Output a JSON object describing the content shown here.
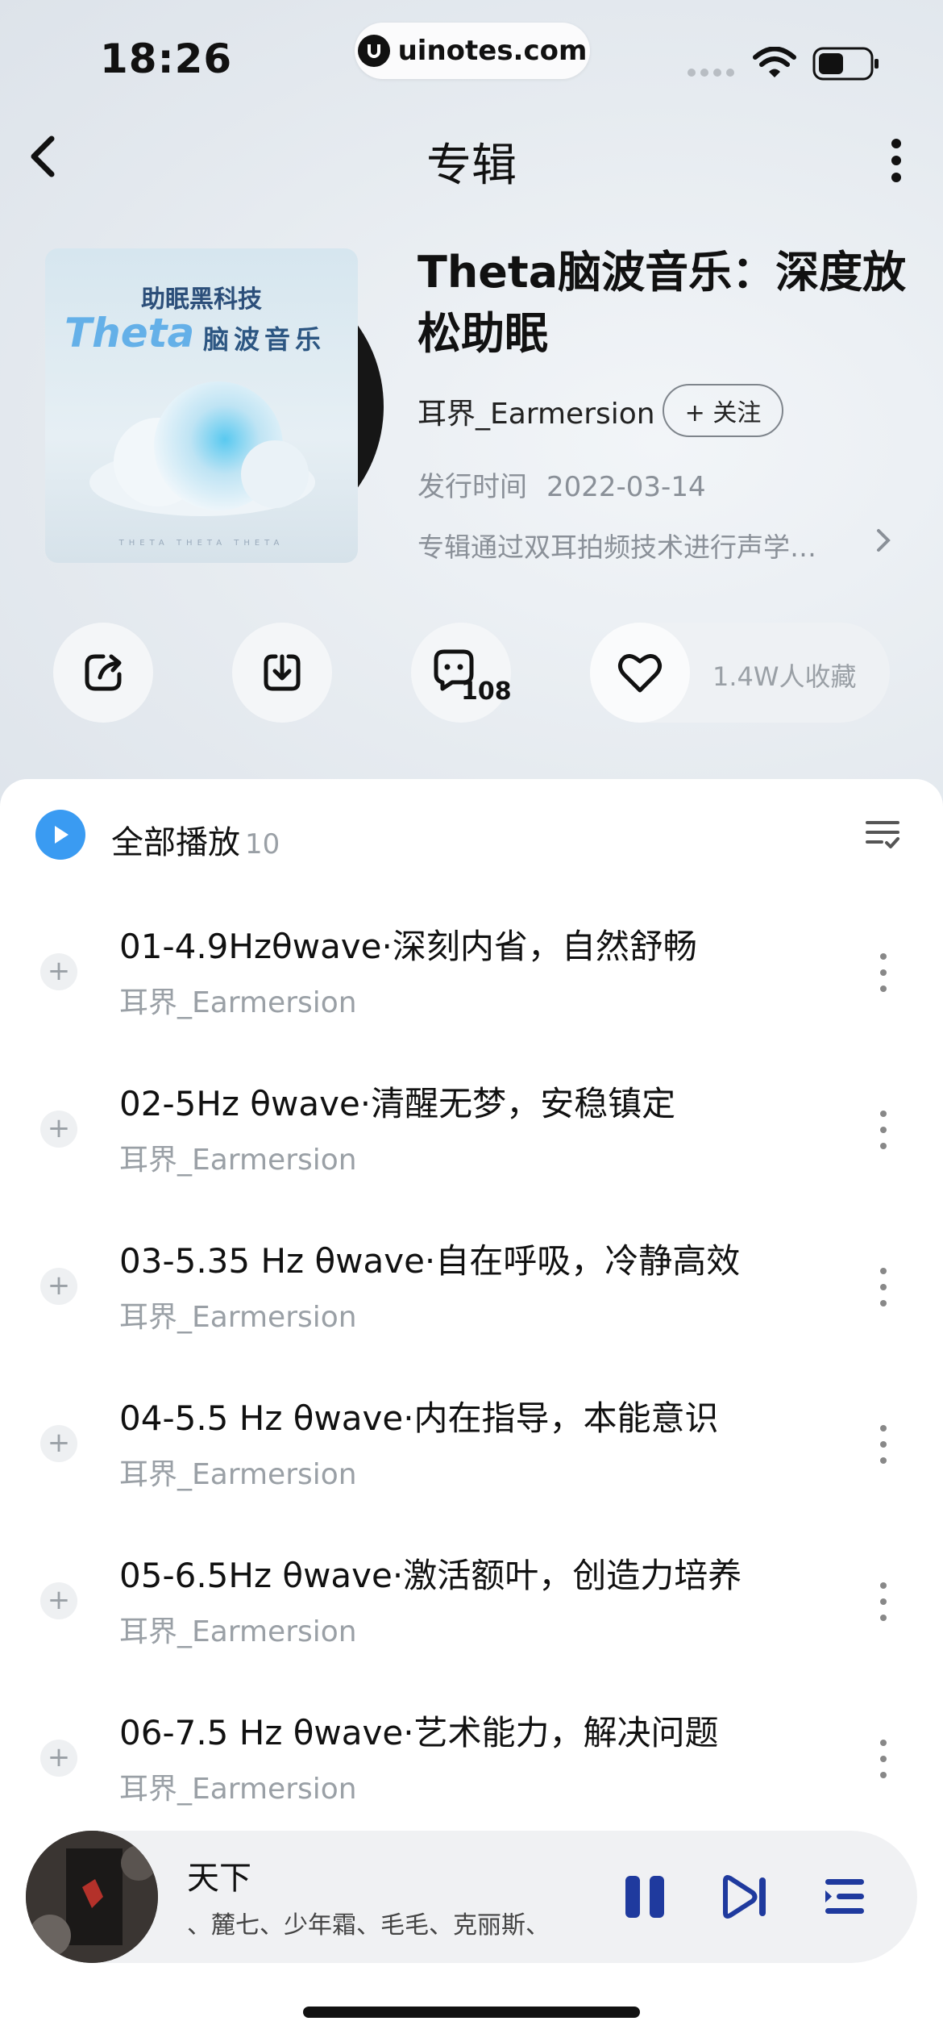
{
  "status_bar": {
    "time": "18:26",
    "url": "uinotes.com"
  },
  "nav": {
    "title": "专辑"
  },
  "album": {
    "cover_text": {
      "line1": "助眠黑科技",
      "brand": "Theta",
      "subtitle": "脑波音乐",
      "bottom": "THETA THETA THETA"
    },
    "title": "Theta脑波音乐：深度放松助眠",
    "artist": "耳界_Earmersion",
    "follow_label": "+ 关注",
    "release_label": "发行时间",
    "release_date": "2022-03-14",
    "description": "专辑通过双耳拍频技术进行声学…"
  },
  "actions": {
    "comment_count": "108",
    "favorites": "1.4W人收藏"
  },
  "list": {
    "play_all_label": "全部播放",
    "count": "10",
    "songs": [
      {
        "title": "01-4.9Hzθwave·深刻内省，自然舒畅",
        "artist": "耳界_Earmersion"
      },
      {
        "title": "02-5Hz θwave·清醒无梦，安稳镇定",
        "artist": "耳界_Earmersion"
      },
      {
        "title": "03-5.35 Hz θwave·自在呼吸，冷静高效",
        "artist": "耳界_Earmersion"
      },
      {
        "title": "04-5.5 Hz θwave·内在指导，本能意识",
        "artist": "耳界_Earmersion"
      },
      {
        "title": "05-6.5Hz θwave·激活额叶，创造力培养",
        "artist": "耳界_Earmersion"
      },
      {
        "title": "06-7.5 Hz θwave·艺术能力，解决问题",
        "artist": "耳界_Earmersion"
      }
    ]
  },
  "player": {
    "title": "天下",
    "artists": "、麓七、少年霜、毛毛、克丽斯、"
  },
  "colors": {
    "accent": "#3a9bf2",
    "text": "#111111",
    "muted": "#9aa0a6"
  },
  "icons": [
    "back-icon",
    "more-vertical-icon",
    "share-icon",
    "download-icon",
    "comment-icon",
    "heart-icon",
    "play-icon",
    "sort-list-icon",
    "add-icon",
    "pause-icon",
    "next-icon",
    "playlist-icon"
  ]
}
